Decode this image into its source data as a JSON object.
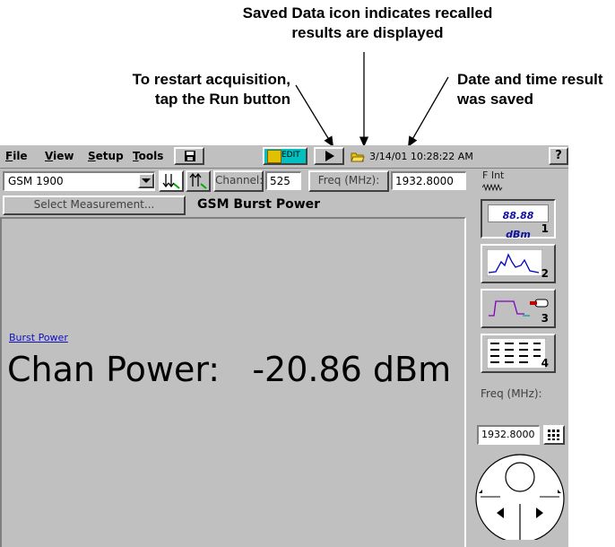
{
  "callouts": {
    "saved_line1": "Saved Data icon indicates recalled",
    "saved_line2": "results are displayed",
    "run_line1": "To restart acquisition,",
    "run_line2": "tap the Run button",
    "date_line1": "Date and time result",
    "date_line2": "was saved"
  },
  "menu": {
    "file_u": "F",
    "file_rest": "ile",
    "view_u": "V",
    "view_rest": "iew",
    "setup_u": "S",
    "setup_rest": "etup",
    "tools_u": "T",
    "tools_rest": "ools"
  },
  "toolbar": {
    "edit_label": "EDIT",
    "saved_timestamp": "3/14/01 10:28:22 AM",
    "help_label": "?"
  },
  "controls": {
    "standard_value": "GSM 1900",
    "channel_label": "Channel:",
    "channel_value": "525",
    "freq_label": "Freq (MHz):",
    "freq_value": "1932.8000",
    "f_int_label": "F Int"
  },
  "measurement": {
    "select_label": "Select Measurement...",
    "title": "GSM Burst Power",
    "link_label": "Burst Power",
    "result_label": "Chan Power:",
    "result_value": "-20.86 dBm"
  },
  "side": {
    "btn1_readout": "88.88 dBm",
    "btn1_num": "1",
    "btn2_num": "2",
    "btn3_num": "3",
    "btn4_num": "4",
    "freq_label": "Freq (MHz):",
    "freq_value": "1932.8000"
  }
}
